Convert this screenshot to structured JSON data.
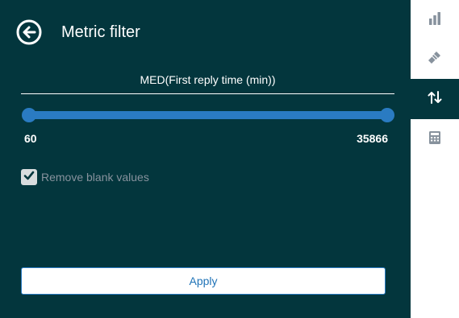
{
  "header": {
    "title": "Metric filter",
    "back_icon": "arrow-left-circle-icon"
  },
  "filter": {
    "metric_label": "MED(First reply time (min))",
    "range_min_label": "60",
    "range_max_label": "35866",
    "selected_min": 60,
    "selected_max": 35866,
    "remove_blank_label": "Remove blank values",
    "remove_blank_checked": true,
    "apply_label": "Apply"
  },
  "rail": {
    "items": [
      {
        "icon": "bar-chart-icon",
        "active": false
      },
      {
        "icon": "paint-brush-icon",
        "active": false
      },
      {
        "icon": "sort-arrows-icon",
        "active": true
      },
      {
        "icon": "calculator-icon",
        "active": false
      }
    ]
  },
  "colors": {
    "panel_bg": "#03363d",
    "accent": "#2a7bc2",
    "rail_icon": "#87929d",
    "muted_text": "#87929d"
  }
}
